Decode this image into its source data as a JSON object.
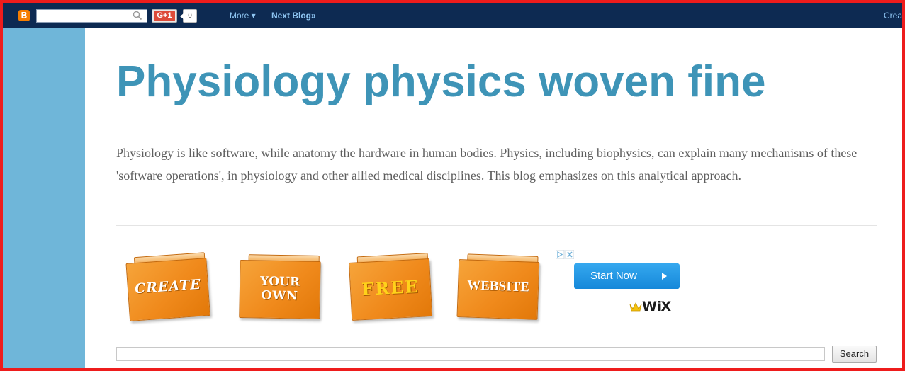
{
  "navbar": {
    "logo_letter": "B",
    "search_placeholder": "",
    "gplus_label": "G+1",
    "gplus_count": "0",
    "more_label": "More ▾",
    "next_blog_label": "Next Blog»",
    "create_blog_label": "Create Blog"
  },
  "blog": {
    "title": "Physiology physics woven fine",
    "description": "Physiology is like software, while anatomy the hardware in human bodies. Physics, including biophysics, can explain many mechanisms of these 'software operations', in physiology and other allied medical disciplines. This blog emphasizes on this analytical approach."
  },
  "ad": {
    "tiles": [
      "CREATE",
      "YOUR",
      "OWN",
      "FREE",
      "WEBSITE"
    ],
    "cta_label": "Start Now",
    "brand": "WiX"
  },
  "search_widget": {
    "value": "",
    "button_label": "Search"
  },
  "colors": {
    "navbar": "#0d2a52",
    "sidebar": "#6fb6d9",
    "title": "#3e94b7",
    "frame": "#ee1c1c"
  }
}
